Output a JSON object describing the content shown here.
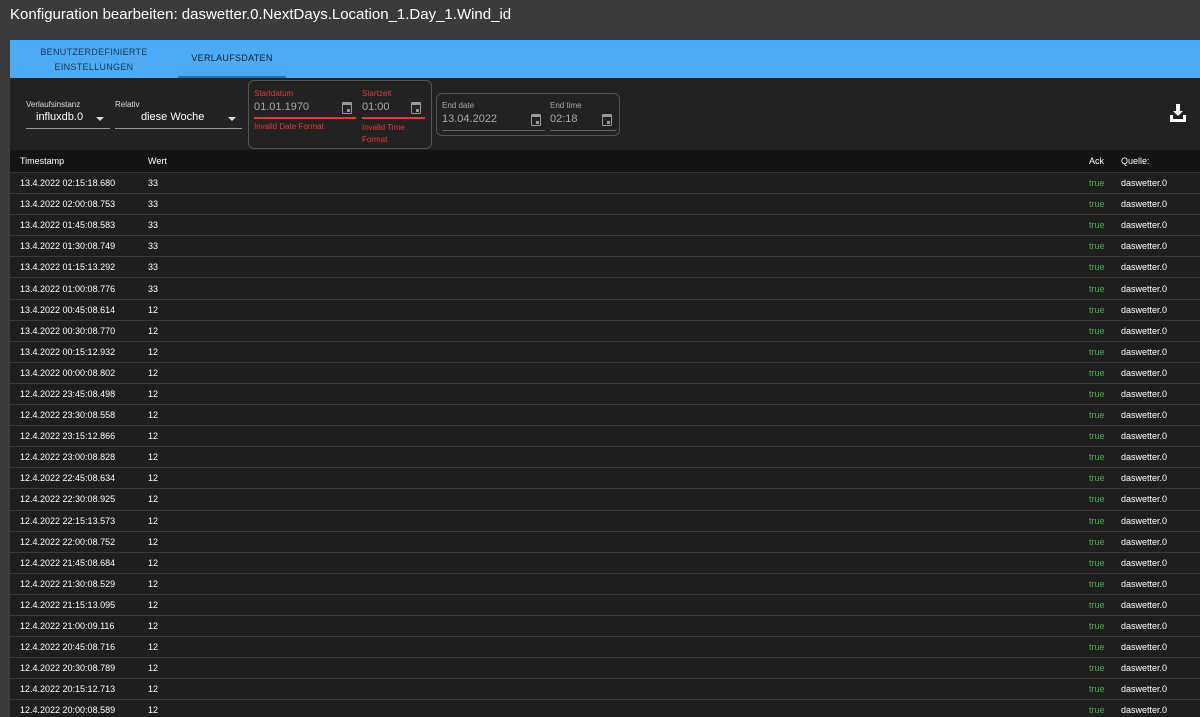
{
  "title": "Konfiguration bearbeiten: daswetter.0.NextDays.Location_1.Day_1.Wind_id",
  "tabs": [
    {
      "label_line1": "BENUTZERDEFINIERTE",
      "label_line2": "EINSTELLUNGEN"
    },
    {
      "label": "VERLAUFSDATEN"
    }
  ],
  "toolbar": {
    "instance_label": "Verlaufsinstanz",
    "instance_value": "influxdb.0",
    "relative_label": "Relativ",
    "relative_value": "diese Woche",
    "start_date_label": "Startdatum",
    "start_date_value": "01.01.1970",
    "start_date_error": "Invalid Date Format",
    "start_time_label": "Startzeit",
    "start_time_value": "01:00",
    "start_time_error_line1": "Invalid Time",
    "start_time_error_line2": "Format",
    "end_date_label": "End date",
    "end_date_value": "13.04.2022",
    "end_time_label": "End time",
    "end_time_value": "02:18"
  },
  "colors": {
    "accent": "#4dabf5",
    "error": "#e53935",
    "ack": "#4caf50"
  },
  "table": {
    "headers": [
      "Timestamp",
      "Wert",
      "Ack",
      "Quelle:"
    ],
    "rows": [
      [
        "13.4.2022 02:15:18.680",
        "33",
        "true",
        "daswetter.0"
      ],
      [
        "13.4.2022 02:00:08.753",
        "33",
        "true",
        "daswetter.0"
      ],
      [
        "13.4.2022 01:45:08.583",
        "33",
        "true",
        "daswetter.0"
      ],
      [
        "13.4.2022 01:30:08.749",
        "33",
        "true",
        "daswetter.0"
      ],
      [
        "13.4.2022 01:15:13.292",
        "33",
        "true",
        "daswetter.0"
      ],
      [
        "13.4.2022 01:00:08.776",
        "33",
        "true",
        "daswetter.0"
      ],
      [
        "13.4.2022 00:45:08.614",
        "12",
        "true",
        "daswetter.0"
      ],
      [
        "13.4.2022 00:30:08.770",
        "12",
        "true",
        "daswetter.0"
      ],
      [
        "13.4.2022 00:15:12.932",
        "12",
        "true",
        "daswetter.0"
      ],
      [
        "13.4.2022 00:00:08.802",
        "12",
        "true",
        "daswetter.0"
      ],
      [
        "12.4.2022 23:45:08.498",
        "12",
        "true",
        "daswetter.0"
      ],
      [
        "12.4.2022 23:30:08.558",
        "12",
        "true",
        "daswetter.0"
      ],
      [
        "12.4.2022 23:15:12.866",
        "12",
        "true",
        "daswetter.0"
      ],
      [
        "12.4.2022 23:00:08.828",
        "12",
        "true",
        "daswetter.0"
      ],
      [
        "12.4.2022 22:45:08.634",
        "12",
        "true",
        "daswetter.0"
      ],
      [
        "12.4.2022 22:30:08.925",
        "12",
        "true",
        "daswetter.0"
      ],
      [
        "12.4.2022 22:15:13.573",
        "12",
        "true",
        "daswetter.0"
      ],
      [
        "12.4.2022 22:00:08.752",
        "12",
        "true",
        "daswetter.0"
      ],
      [
        "12.4.2022 21:45:08.684",
        "12",
        "true",
        "daswetter.0"
      ],
      [
        "12.4.2022 21:30:08.529",
        "12",
        "true",
        "daswetter.0"
      ],
      [
        "12.4.2022 21:15:13.095",
        "12",
        "true",
        "daswetter.0"
      ],
      [
        "12.4.2022 21:00:09.116",
        "12",
        "true",
        "daswetter.0"
      ],
      [
        "12.4.2022 20:45:08.716",
        "12",
        "true",
        "daswetter.0"
      ],
      [
        "12.4.2022 20:30:08.789",
        "12",
        "true",
        "daswetter.0"
      ],
      [
        "12.4.2022 20:15:12.713",
        "12",
        "true",
        "daswetter.0"
      ],
      [
        "12.4.2022 20:00:08.589",
        "12",
        "true",
        "daswetter.0"
      ]
    ]
  }
}
